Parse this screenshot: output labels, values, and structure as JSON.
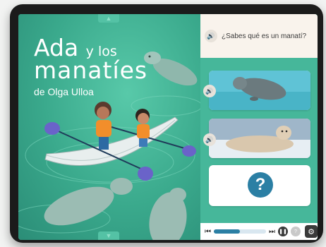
{
  "book": {
    "title_word1": "Ada",
    "title_word2": "y los",
    "title_word3": "manatíes",
    "author": "de Olga Ulloa"
  },
  "question": {
    "text": "¿Sabes qué es un manatí?"
  },
  "answers": [
    {
      "image": "manatee-photo"
    },
    {
      "image": "seal-photo"
    },
    {
      "symbol": "?"
    }
  ],
  "player": {
    "progress": 0.5
  },
  "icons": {
    "speaker": "speaker-icon",
    "prev": "skip-back-icon",
    "next": "skip-forward-icon",
    "pause": "pause-icon",
    "help": "help-icon",
    "settings": "gear-icon"
  },
  "colors": {
    "accent": "#2b7fa4",
    "cover_green": "#46b79a",
    "question_bg": "#f9f3ec"
  }
}
